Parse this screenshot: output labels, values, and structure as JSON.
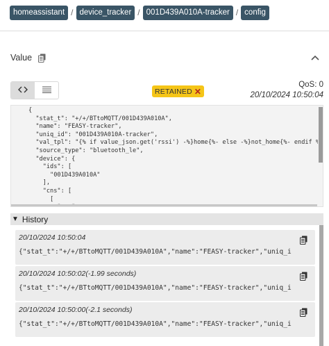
{
  "breadcrumb": [
    "homeassistant",
    "device_tracker",
    "001D439A010A-tracker",
    "config"
  ],
  "value_section": {
    "label": "Value",
    "copy_icon": "copy-icon",
    "collapse_icon": "chevron-up-icon"
  },
  "view_toggle": {
    "code_icon": "code-icon",
    "list_icon": "list-icon",
    "active": "code"
  },
  "retained": {
    "label": "RETAINED",
    "close_glyph": "✕"
  },
  "qos": "QoS: 0",
  "timestamp": "20/10/2024 10:50:04",
  "payload_lines": [
    "{",
    "  \"stat_t\": \"+/+/BTtoMQTT/001D439A010A\",",
    "  \"name\": \"FEASY-tracker\",",
    "  \"uniq_id\": \"001D439A010A-tracker\",",
    "  \"val_tpl\": \"{% if value_json.get('rssi') -%}home{%- else -%}not_home{%- endif %}\",",
    "  \"source_type\": \"bluetooth_le\",",
    "  \"device\": {",
    "    \"ids\": [",
    "      \"001D439A010A\"",
    "    ],",
    "    \"cns\": [",
    "      [",
    "        \"mac\","
  ],
  "history": {
    "title": "History",
    "items": [
      {
        "time": "20/10/2024 10:50:04",
        "value": "{\"stat_t\":\"+/+/BTtoMQTT/001D439A010A\",\"name\":\"FEASY-tracker\",\"uniq_i"
      },
      {
        "time": "20/10/2024 10:50:02(-1.99 seconds)",
        "value": "{\"stat_t\":\"+/+/BTtoMQTT/001D439A010A\",\"name\":\"FEASY-tracker\",\"uniq_i"
      },
      {
        "time": "20/10/2024 10:50:00(-2.1 seconds)",
        "value": "{\"stat_t\":\"+/+/BTtoMQTT/001D439A010A\",\"name\":\"FEASY-tracker\",\"uniq_i"
      }
    ]
  }
}
